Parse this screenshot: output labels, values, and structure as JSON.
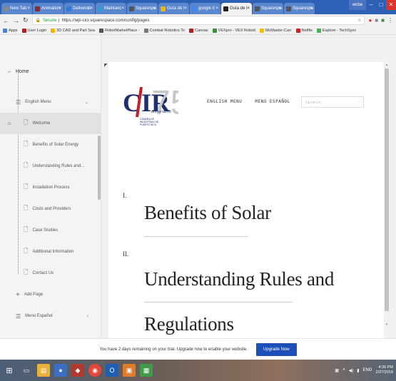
{
  "browser": {
    "tabs": [
      {
        "label": "New Tab",
        "color": "#888888",
        "active": false
      },
      {
        "label": "Animation",
        "color": "#8a2b2b",
        "active": false
      },
      {
        "label": "Deliverab",
        "color": "#2a7ddf",
        "active": false
      },
      {
        "label": "Maintanc",
        "color": "#2f9bd7",
        "active": false
      },
      {
        "label": "Squarespa",
        "color": "#555555",
        "active": false
      },
      {
        "label": "Guía de I",
        "color": "#f4b400",
        "active": false
      },
      {
        "label": "google ti",
        "color": "#4285f4",
        "active": false
      },
      {
        "label": "Guía de I",
        "color": "#222222",
        "active": true
      },
      {
        "label": "Squarespa",
        "color": "#555555",
        "active": false
      },
      {
        "label": "Squarespa",
        "color": "#555555",
        "active": false
      }
    ],
    "user_chip": "wobe",
    "secure_label": "Secure",
    "url": "https://wpi-cicr.squarespace.com/config/pages",
    "bookmarks": [
      {
        "label": "Apps",
        "color": "#4a7fd6"
      },
      {
        "label": "User Login",
        "color": "#b31f24"
      },
      {
        "label": "3D CAD and Part Sea",
        "color": "#f0b400"
      },
      {
        "label": "RobotMarketPlace -",
        "color": "#555555"
      },
      {
        "label": "Combat Robotics To",
        "color": "#777777"
      },
      {
        "label": "Canvas",
        "color": "#b31f24"
      },
      {
        "label": "VEXpro - VEX Roboti",
        "color": "#3a8f3a"
      },
      {
        "label": "McMaster-Carr",
        "color": "#f0c000"
      },
      {
        "label": "Netflix",
        "color": "#d81f26"
      },
      {
        "label": "Explore - TechSync",
        "color": "#4caf50"
      }
    ]
  },
  "sidebar": {
    "home_label": "Home",
    "items": [
      {
        "label": "English Menu",
        "kind": "section"
      },
      {
        "label": "Welcome",
        "kind": "child",
        "active": true
      },
      {
        "label": "Benefits of Solar Energy",
        "kind": "child"
      },
      {
        "label": "Understanding Rules and...",
        "kind": "child"
      },
      {
        "label": "Installation Process",
        "kind": "child"
      },
      {
        "label": "Costs and Providers",
        "kind": "child"
      },
      {
        "label": "Case Studies",
        "kind": "child"
      },
      {
        "label": "Additional Information",
        "kind": "child"
      },
      {
        "label": "Contact Us",
        "kind": "child"
      },
      {
        "label": "Add Page",
        "kind": "add"
      },
      {
        "label": "Menú Español",
        "kind": "section"
      }
    ]
  },
  "site": {
    "logo_letters": "CIR",
    "logo_number": "75",
    "logo_anniversary": "aniversario",
    "logo_org": [
      "CÁMARA DE",
      "INDUSTRIAS DE",
      "PUERTO RICO"
    ],
    "nav": [
      "ENGLISH MENU",
      "MENÚ ESPAÑOL"
    ],
    "search_placeholder": "SEARCH",
    "sections": [
      {
        "numeral": "I.",
        "title": "Benefits of Solar"
      },
      {
        "numeral": "II.",
        "title": "Understanding Rules and"
      },
      {
        "numeral": "",
        "title": "Regulations"
      }
    ]
  },
  "banner": {
    "message": "You have 2 days remaining on your trial. Upgrade now to enable your website.",
    "button": "Upgrade Now"
  },
  "taskbar": {
    "lang": "ENG",
    "time": "4:36 PM",
    "date": "2/27/2018"
  },
  "colors": {
    "chrome_blue": "#2d61b6",
    "upgrade_button": "#1d4fb8",
    "logo_red": "#c3202a",
    "logo_blue": "#1f2f6d"
  }
}
